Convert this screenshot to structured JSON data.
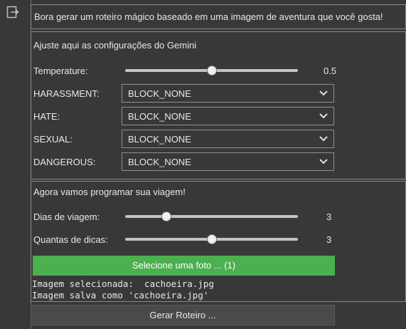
{
  "gutter": {
    "icon": "output-exit-icon"
  },
  "intro": {
    "text": "Bora gerar um roteiro mágico baseado em uma imagem de aventura que você gosta!"
  },
  "config": {
    "title": "Ajuste aqui as configurações do Gemini",
    "temperature": {
      "label": "Temperature:",
      "value_text": "0.5",
      "value": 0.5,
      "min": 0,
      "max": 1
    },
    "safety": [
      {
        "label": "HARASSMENT:",
        "value": "BLOCK_NONE"
      },
      {
        "label": "HATE:",
        "value": "BLOCK_NONE"
      },
      {
        "label": "SEXUAL:",
        "value": "BLOCK_NONE"
      },
      {
        "label": "DANGEROUS:",
        "value": "BLOCK_NONE"
      }
    ]
  },
  "travel": {
    "title": "Agora vamos programar sua viagem!",
    "days": {
      "label": "Dias de viagem:",
      "value_text": "3",
      "value": 3,
      "min": 1,
      "max": 10
    },
    "tips": {
      "label": "Quantas de dicas:",
      "value_text": "3",
      "value": 3,
      "min": 1,
      "max": 5
    },
    "upload_button": "Selecione uma foto ... (1)",
    "output": [
      "Imagem selecionada:  cachoeira.jpg",
      "Imagem salva como 'cachoeira.jpg'"
    ]
  },
  "generate_button": "Gerar Roteiro ...",
  "colors": {
    "upload_button": "#4caf50",
    "background": "#383838"
  }
}
